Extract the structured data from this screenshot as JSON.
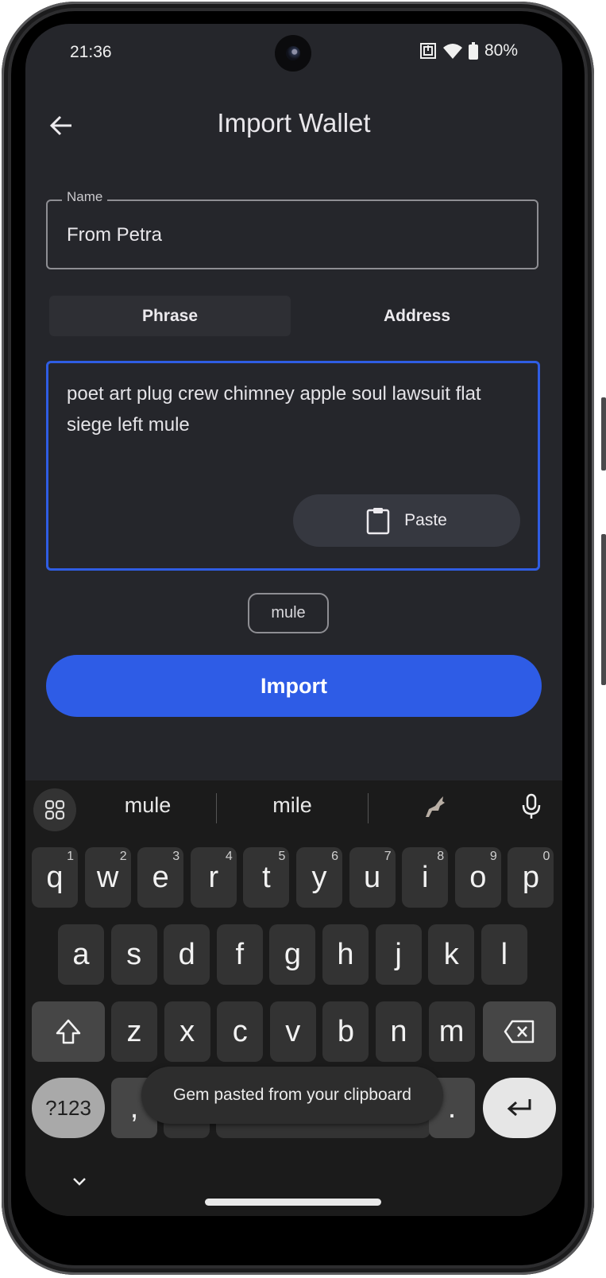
{
  "status_bar": {
    "time": "21:36",
    "battery_percent": "80%",
    "icons": [
      "nfc-icon",
      "wifi-icon",
      "battery-icon"
    ]
  },
  "header": {
    "title": "Import Wallet",
    "back_icon": "arrow-left-icon"
  },
  "form": {
    "name_label": "Name",
    "name_value": "From Petra",
    "tabs": [
      {
        "label": "Phrase",
        "selected": true
      },
      {
        "label": "Address",
        "selected": false
      }
    ],
    "phrase_value": "poet art plug crew chimney apple soul lawsuit flat siege left mule",
    "paste_label": "Paste",
    "suggestion_chip": "mule",
    "import_label": "Import"
  },
  "colors": {
    "accent": "#2e5ce6",
    "background": "#25262b",
    "focus_border": "#2f5de3"
  },
  "keyboard": {
    "suggestions": [
      "mule",
      "mile"
    ],
    "suggestion_emoji_icon": "donkey-emoji-icon",
    "row1": [
      {
        "k": "q",
        "h": "1"
      },
      {
        "k": "w",
        "h": "2"
      },
      {
        "k": "e",
        "h": "3"
      },
      {
        "k": "r",
        "h": "4"
      },
      {
        "k": "t",
        "h": "5"
      },
      {
        "k": "y",
        "h": "6"
      },
      {
        "k": "u",
        "h": "7"
      },
      {
        "k": "i",
        "h": "8"
      },
      {
        "k": "o",
        "h": "9"
      },
      {
        "k": "p",
        "h": "0"
      }
    ],
    "row2": [
      "a",
      "s",
      "d",
      "f",
      "g",
      "h",
      "j",
      "k",
      "l"
    ],
    "row3": [
      "z",
      "x",
      "c",
      "v",
      "b",
      "n",
      "m"
    ],
    "symbols_label": "?123",
    "comma": ",",
    "period": "."
  },
  "toast": {
    "message": "Gem pasted from your clipboard"
  }
}
